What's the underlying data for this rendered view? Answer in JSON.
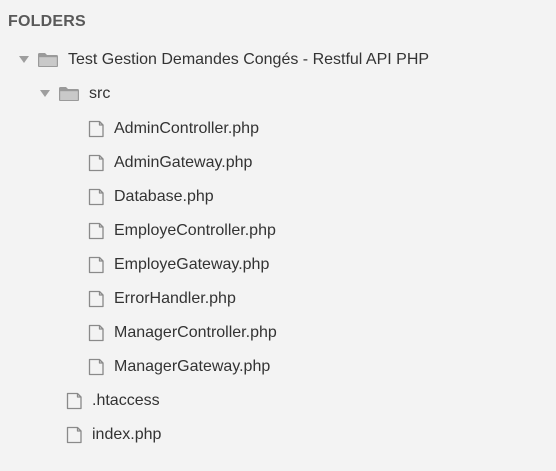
{
  "sidebar": {
    "header": "FOLDERS",
    "root": {
      "label": "Test Gestion Demandes Congés - Restful API PHP",
      "expanded": true,
      "icon": "folder-icon"
    },
    "src": {
      "label": "src",
      "expanded": true,
      "icon": "folder-icon"
    },
    "src_files": [
      "AdminController.php",
      "AdminGateway.php",
      "Database.php",
      "EmployeController.php",
      "EmployeGateway.php",
      "ErrorHandler.php",
      "ManagerController.php",
      "ManagerGateway.php"
    ],
    "root_files": [
      ".htaccess",
      "index.php"
    ]
  },
  "colors": {
    "background": "#f3f3f3",
    "text": "#333333",
    "header": "#595959",
    "icon": "#8a8a8a"
  }
}
